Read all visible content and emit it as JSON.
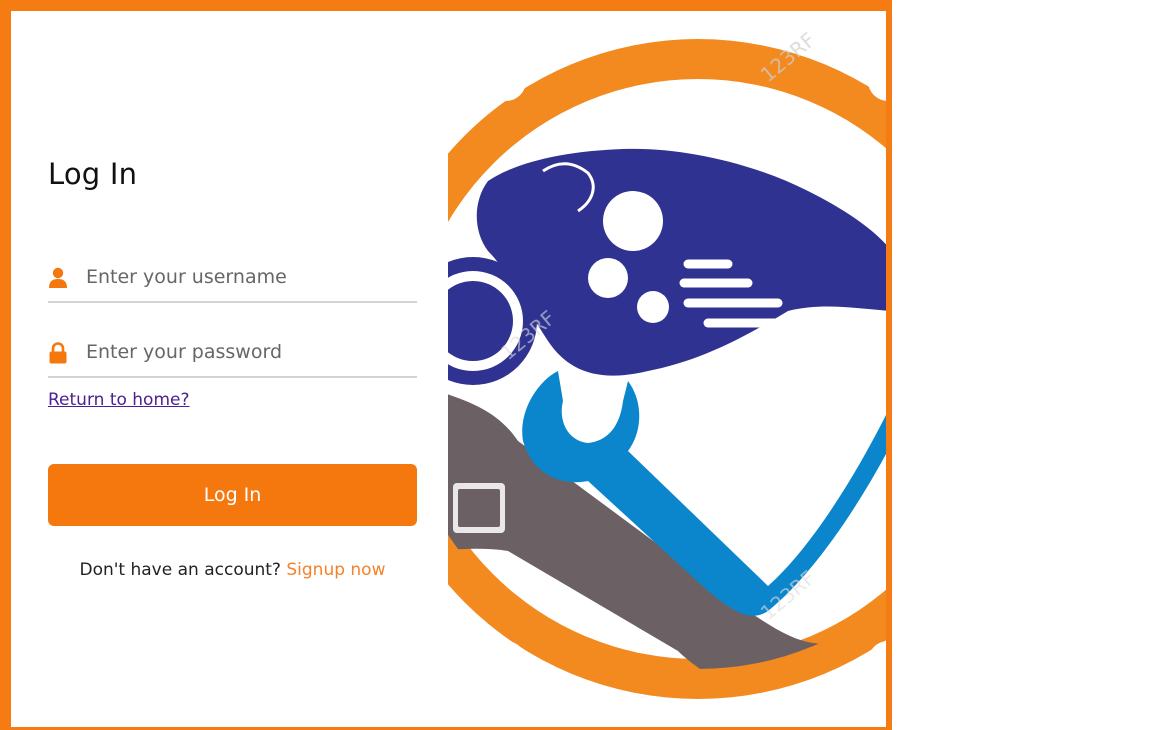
{
  "login": {
    "title": "Log In",
    "username_placeholder": "Enter your username",
    "password_placeholder": "Enter your password",
    "return_home": "Return to home?",
    "submit_label": "Log In",
    "signup_prompt": "Don't have an account?",
    "signup_link": "Signup now"
  },
  "colors": {
    "accent": "#f5780f",
    "frame": "#f57c12",
    "link": "#4b1f93",
    "signup_link": "#f5822a",
    "divider": "#d3d3d3"
  },
  "icons": {
    "username": "user-icon",
    "password": "lock-icon",
    "artwork": "motorcycle-repair-logo"
  },
  "artwork": {
    "watermark": "123RF"
  }
}
